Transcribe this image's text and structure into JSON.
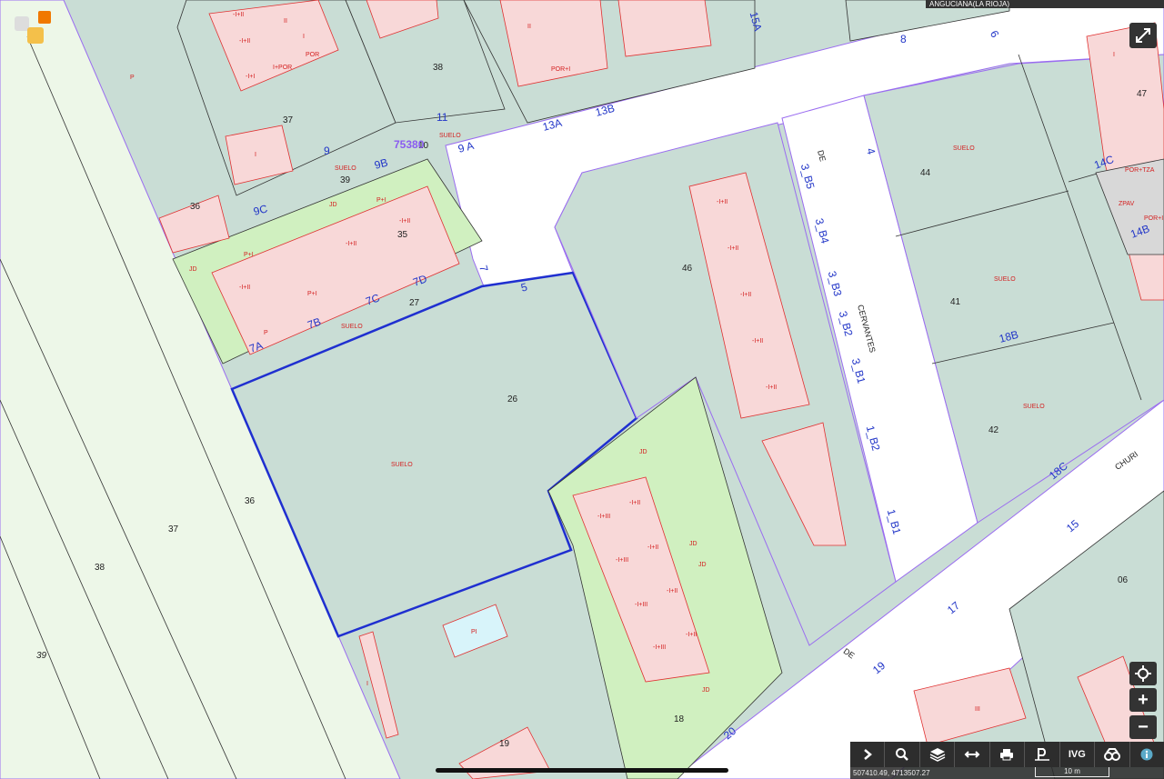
{
  "header": {
    "location_label": "ANGUCIANA(LA RIOJA)"
  },
  "map": {
    "street_labels": [
      "DE",
      "CERVANTES",
      "DE",
      "CHURI"
    ],
    "parcel_numbers": [
      "37",
      "38",
      "37",
      "39",
      "10",
      "36",
      "35",
      "27",
      "46",
      "26",
      "44",
      "41",
      "42",
      "47",
      "36",
      "37",
      "38",
      "39",
      "18",
      "19",
      "06"
    ],
    "address_numbers": [
      "15A",
      "8",
      "6",
      "11",
      "13A",
      "13B",
      "9",
      "9 A",
      "9B",
      "9C",
      "7",
      "5",
      "7A",
      "7B",
      "7C",
      "7D",
      "3_B5",
      "3_B4",
      "3_B3",
      "3_B2",
      "3_B1",
      "1_B2",
      "1_B1",
      "4",
      "14C",
      "14B",
      "18B",
      "18C",
      "15",
      "17",
      "19",
      "20"
    ],
    "parcel_ref": "75380",
    "use_codes": [
      "-I+II",
      "II",
      "-I+II",
      "I",
      "-I+I",
      "I+POR",
      "POR",
      "SUELO",
      "I",
      "SUELO",
      "JD",
      "P+I",
      "-I+II",
      "JD",
      "P+I",
      "-I+II",
      "P+I",
      "-I+II",
      "P",
      "SUELO",
      "-I+II",
      "-I+II",
      "-I+II",
      "-I+II",
      "-I+II",
      "SUELO",
      "JD",
      "-I+II",
      "-I+III",
      "-I+III",
      "-I+II",
      "-I+III",
      "-I+II",
      "-I+III",
      "-I+II",
      "JD",
      "JD",
      "PI",
      "JD",
      "SUELO",
      "SUELO",
      "SUELO",
      "I",
      "POR+TZA",
      "ZPAV",
      "POR+I",
      "III",
      "I",
      "II",
      "POR+I",
      "P"
    ]
  },
  "controls": {
    "expand_icon": "expand-icon",
    "locate_icon": "locate-icon",
    "zoom_in_label": "+",
    "zoom_out_label": "−"
  },
  "toolbar": {
    "items": [
      {
        "name": "chevron-right-icon"
      },
      {
        "name": "search-icon"
      },
      {
        "name": "layers-icon"
      },
      {
        "name": "measure-icon"
      },
      {
        "name": "print-icon"
      },
      {
        "name": "parking-icon"
      },
      {
        "name": "ivg-icon",
        "label": "IVG"
      },
      {
        "name": "binoculars-icon"
      },
      {
        "name": "info-icon"
      }
    ]
  },
  "status": {
    "coordinates": "507410.49, 4713507.27",
    "scale_label": "10 m"
  },
  "colors": {
    "parcel_fill": "#c9ddd5",
    "garden_fill": "#d0f0c0",
    "building_fill": "#f8d8d8",
    "road_fill": "#ffffff",
    "river_fill": "#edf7e8",
    "pool_fill": "#d8f4fa",
    "selected_outline": "#1f2fd0",
    "building_outline": "#e03030",
    "road_outline": "#a070f0"
  }
}
